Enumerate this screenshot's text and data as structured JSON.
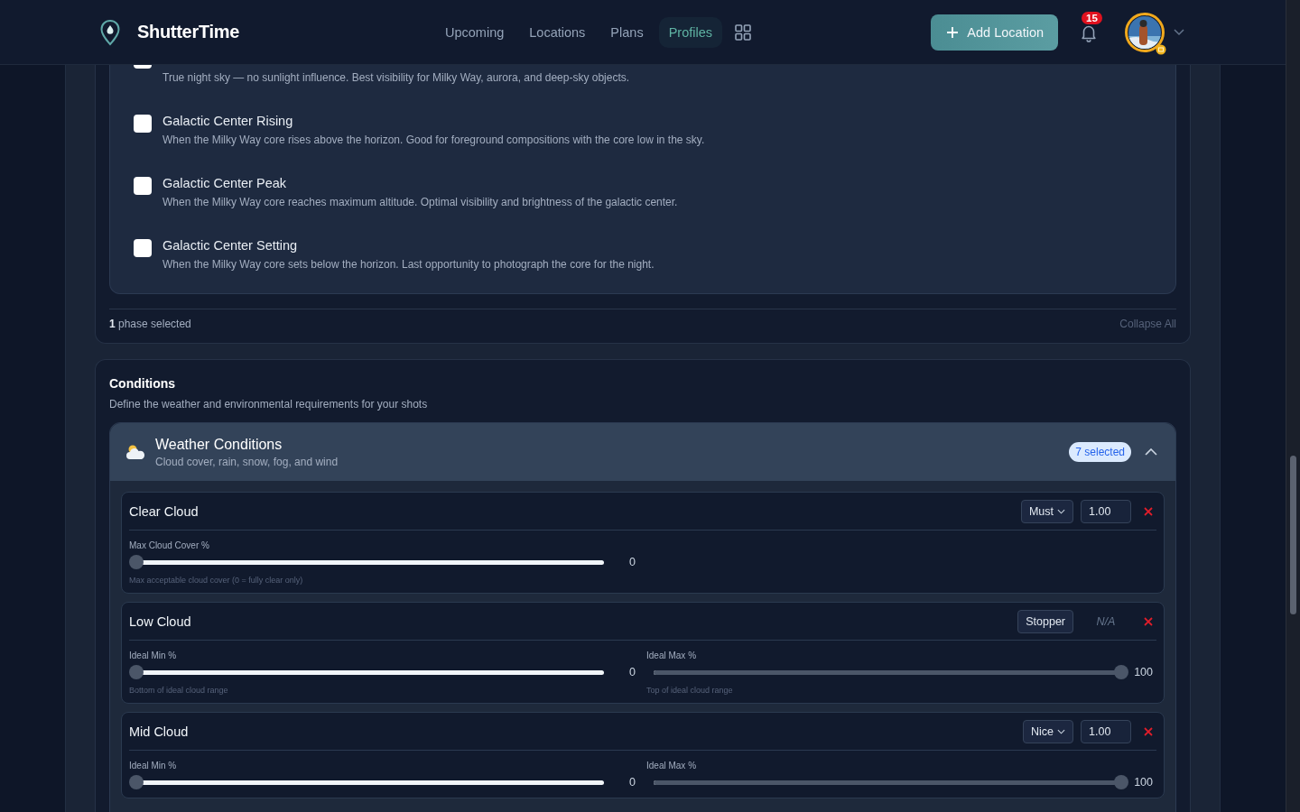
{
  "header": {
    "brand": "ShutterTime",
    "nav": [
      {
        "label": "Upcoming",
        "selected": false
      },
      {
        "label": "Locations",
        "selected": false
      },
      {
        "label": "Plans",
        "selected": false
      },
      {
        "label": "Profiles",
        "selected": true
      }
    ],
    "add_button": "Add Location",
    "notification_count": "15"
  },
  "phases": {
    "items": [
      {
        "kind": "partial",
        "description": "True night sky — no sunlight influence. Best visibility for Milky Way, aurora, and deep-sky objects.",
        "checked": false
      },
      {
        "kind": "full",
        "title": "Galactic Center Rising",
        "description": "When the Milky Way core rises above the horizon. Good for foreground compositions with the core low in the sky.",
        "checked": false
      },
      {
        "kind": "full",
        "title": "Galactic Center Peak",
        "description": "When the Milky Way core reaches maximum altitude. Optimal visibility and brightness of the galactic center.",
        "checked": false
      },
      {
        "kind": "full",
        "title": "Galactic Center Setting",
        "description": "When the Milky Way core sets below the horizon. Last opportunity to photograph the core for the night.",
        "checked": false
      }
    ],
    "summary": "**1** phase selected",
    "collapse_all": "Collapse All"
  },
  "conditions": {
    "title": "Conditions",
    "subtitle": "Define the weather and environmental requirements for your shots",
    "group": {
      "title": "Weather Conditions",
      "subtitle": "Cloud cover, rain, snow, fog, and wind",
      "badge": "7 selected",
      "expanded": true
    },
    "rows": [
      {
        "name": "Clear Cloud",
        "priority": {
          "label": "Must",
          "kind": "dropdown"
        },
        "weight": {
          "kind": "field",
          "value": "1.00"
        },
        "sliders": [
          {
            "label": "Max Cloud Cover %",
            "level": 0,
            "value": "0",
            "hint": "Max acceptable cloud cover (0 = fully clear only)"
          }
        ]
      },
      {
        "name": "Low Cloud",
        "priority": {
          "label": "Stopper",
          "kind": "fixed"
        },
        "weight": {
          "kind": "none",
          "value": "N/A"
        },
        "sliders": [
          {
            "label": "Ideal Min %",
            "level": 0,
            "value": "0",
            "hint": "Bottom of ideal cloud range"
          },
          {
            "label": "Ideal Max %",
            "level": 1,
            "value": "100",
            "hint": "Top of ideal cloud range"
          }
        ]
      },
      {
        "name": "Mid Cloud",
        "priority": {
          "label": "Nice",
          "kind": "dropdown"
        },
        "weight": {
          "kind": "field",
          "value": "1.00"
        },
        "sliders": [
          {
            "label": "Ideal Min %",
            "level": 0,
            "value": "0"
          },
          {
            "label": "Ideal Max %",
            "level": 1,
            "value": "100"
          }
        ]
      }
    ]
  }
}
